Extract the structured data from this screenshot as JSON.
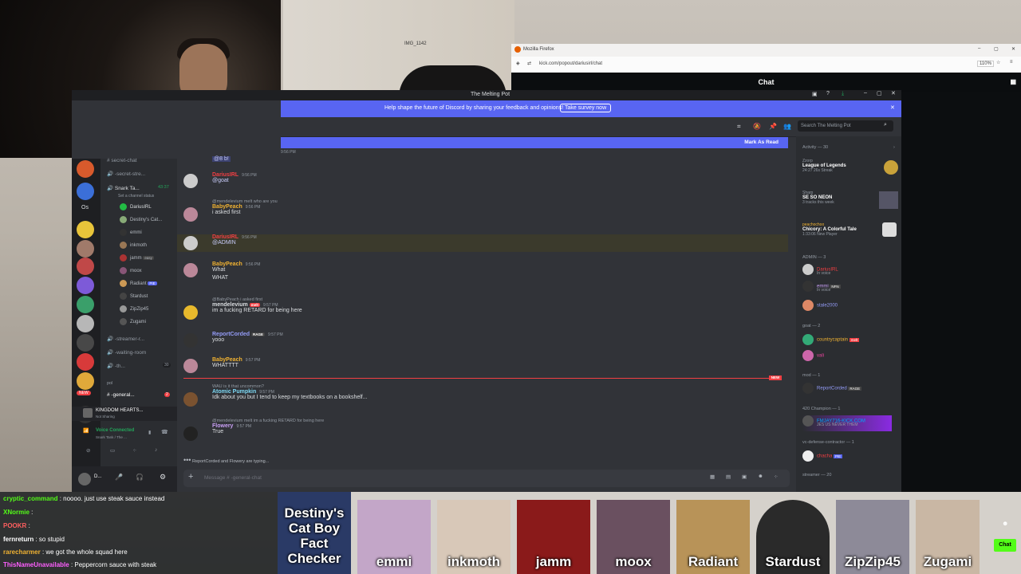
{
  "firefox": {
    "title": "Mozilla Firefox",
    "url": "kick.com/popout/dariusirl/chat",
    "zoom": "110%",
    "chat_header": "Chat"
  },
  "background": {
    "object_label": "IMG_1142"
  },
  "discord": {
    "window_title": "The Melting Pot",
    "banner_text": "Help shape the future of Discord by sharing your feedback and opinions!",
    "banner_button": "Take survey now",
    "search_placeholder": "Search The Melting Pot",
    "mark_as_read": "Mark As Read",
    "top_time": "9:56 PM",
    "channels": {
      "secret_chat": "secret-chat",
      "secret_stream": "-secret-stre...",
      "voice_channel": "Snark Ta...",
      "voice_timer": "43:37",
      "voice_status": "Set a channel status",
      "voice_users": [
        "DariusIRL",
        "Destiny's Cat...",
        "emmi",
        "inkmoth",
        "jamm",
        "moox",
        "Radiant",
        "Stardust",
        "ZipZip45",
        "Zugami"
      ],
      "jamm_tag": "easy",
      "radiant_tag": "PIE",
      "streamer": "-streamer-r...",
      "waiting_room": "-waiting-room",
      "th": "-th...",
      "th_count": "30",
      "category": "pol",
      "general": "-general...",
      "general_badge": "2"
    },
    "server_left_label": "Os",
    "new_label": "NEW",
    "activity": {
      "name": "KINGDOM HEARTS...",
      "sub": "Not Sharing"
    },
    "voice_connected": {
      "title": "Voice Connected",
      "sub": "Snark Tank / The ..."
    },
    "user": {
      "name": "D..."
    },
    "messages": [
      {
        "reply": "",
        "name": "",
        "time": "",
        "text": "@8 b!",
        "color": "#dbdee1"
      },
      {
        "reply": "",
        "name": "DariusIRL",
        "time": "9:56 PM",
        "text": "@goat",
        "color": "#f23f43"
      },
      {
        "reply": "@mendelevium  melt  who are you",
        "name": "BabyPeach",
        "time": "9:56 PM",
        "text": "i asked first",
        "color": "#f0b232"
      },
      {
        "reply": "",
        "name": "DariusIRL",
        "time": "9:56 PM",
        "text": "@ADMIN",
        "color": "#f23f43"
      },
      {
        "reply": "",
        "name": "BabyPeach",
        "time": "9:56 PM",
        "text": "What",
        "text2": "WHAT",
        "color": "#f0b232"
      },
      {
        "reply": "@BabyPeach i asked first",
        "name": "mendelevium",
        "time": "9:57 PM",
        "text": "im a fucking RETARD for being here",
        "color": "#dbdee1"
      },
      {
        "reply": "",
        "name": "ReportCorded",
        "time": "9:57 PM",
        "text": "yooo",
        "color": "#949cf7"
      },
      {
        "reply": "",
        "name": "BabyPeach",
        "time": "9:57 PM",
        "text": "WHATTTT",
        "color": "#f0b232"
      },
      {
        "reply": "WAU  is it that uncommon?",
        "name": "Atomic Pumpkin",
        "time": "9:57 PM",
        "text": "Idk about you but I tend to keep my textbooks on a bookshelf...",
        "color": "#7dd9f5"
      },
      {
        "reply": "@mendelevium  melt  im a fucking RETARD for being here",
        "name": "Flowery",
        "time": "9:57 PM",
        "text": "True",
        "color": "#c9a0f5"
      }
    ],
    "badges": {
      "melt": "melt",
      "rage": "RAGE",
      "new": "NEW"
    },
    "typing": "ReportCorded and Flowery are typing...",
    "input_placeholder": "Message #  -general-chat",
    "members": {
      "activity_header": "Activity — 30",
      "activities": [
        {
          "user": "Zzorp",
          "title": "League of Legends",
          "sub": "24:27  26s Streak"
        },
        {
          "user": "Sharp",
          "title": "SE SO NEON",
          "sub": "3 tracks this week"
        },
        {
          "user": "peachochoo",
          "title": "Chicory: A Colorful Tale",
          "sub": "1:33:06  New Player"
        }
      ],
      "admin_header": "ADMIN — 3",
      "admins": [
        {
          "name": "DariusIRL",
          "sub": "In voice",
          "color": "#f23f43"
        },
        {
          "name": "emmi",
          "tag": "NFN",
          "sub": "In voice",
          "color": "#c9a0f5"
        },
        {
          "name": "stale2000",
          "sub": "",
          "color": "#949cf7"
        }
      ],
      "goat_header": "goat — 2",
      "goats": [
        {
          "name": "countrycaptain",
          "tag": "melt",
          "color": "#f0b232"
        },
        {
          "name": "vali",
          "color": "#eb459e"
        }
      ],
      "mod_header": "mod — 1",
      "mods": [
        {
          "name": "ReportCorded",
          "tag": "RAGE",
          "color": "#949cf7"
        }
      ],
      "champion_header": "420 Champion — 1",
      "champions": [
        {
          "name": "FMJAY716-KICK.COM",
          "sub": "JES US NEVER THEM",
          "color": "#00a8fc"
        }
      ],
      "vc_header": "vc-defense-contractor — 1",
      "vcs": [
        {
          "name": "chacha",
          "tag": "PIE",
          "color": "#f23f43"
        }
      ],
      "streamer_header": "streamer — 20"
    }
  },
  "chat_overlay": [
    {
      "user": "cryptic_command",
      "text": ": noooo. just use steak sauce instead",
      "color": "#53fc18"
    },
    {
      "user": "XNormie",
      "text": ":",
      "color": "#53fc18"
    },
    {
      "user": "POOKR",
      "text": ":",
      "color": "#ff5f5f"
    },
    {
      "user": "fernreturn",
      "text": ": so stupid",
      "color": "#ffffff"
    },
    {
      "user": "rarecharmer",
      "text": ": we got the whole squad here",
      "color": "#f0b232"
    },
    {
      "user": "ThisNameUnavailable",
      "text": ": Peppercorn sauce with steak",
      "color": "#ff5fff"
    }
  ],
  "voice_tiles": [
    "Destiny's Cat Boy Fact Checker",
    "emmi",
    "inkmoth",
    "jamm",
    "moox",
    "Radiant",
    "Stardust",
    "ZipZip45",
    "Zugami"
  ],
  "kick_chat_button": "Chat",
  "colors": {
    "discord_bg": "#313338",
    "blurple": "#5865f2",
    "kick_green": "#53fc18"
  }
}
